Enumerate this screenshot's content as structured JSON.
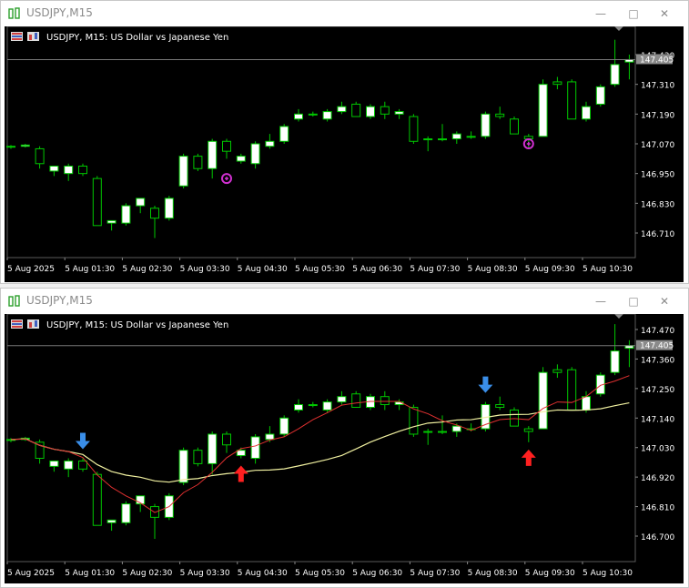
{
  "windows": [
    {
      "title": "USDJPY,M15",
      "chart_label": "USDJPY, M15:  US Dollar vs Japanese Yen",
      "current_price": "147.405",
      "y_ticks": [
        "147.430",
        "147.310",
        "147.190",
        "147.070",
        "146.950",
        "146.830",
        "146.710"
      ],
      "x_ticks": [
        "5 Aug 2025",
        "5 Aug 01:30",
        "5 Aug 02:30",
        "5 Aug 03:30",
        "5 Aug 04:30",
        "5 Aug 05:30",
        "5 Aug 06:30",
        "5 Aug 07:30",
        "5 Aug 08:30",
        "5 Aug 09:30",
        "5 Aug 10:30"
      ]
    },
    {
      "title": "USDJPY,M15",
      "chart_label": "USDJPY, M15:  US Dollar vs Japanese Yen",
      "current_price": "147.405",
      "y_ticks": [
        "147.470",
        "147.360",
        "147.250",
        "147.140",
        "147.030",
        "146.920",
        "146.810",
        "146.700"
      ],
      "x_ticks": [
        "5 Aug 2025",
        "5 Aug 01:30",
        "5 Aug 02:30",
        "5 Aug 03:30",
        "5 Aug 04:30",
        "5 Aug 05:30",
        "5 Aug 06:30",
        "5 Aug 07:30",
        "5 Aug 08:30",
        "5 Aug 09:30",
        "5 Aug 10:30"
      ]
    }
  ],
  "chart_data": [
    {
      "type": "candlestick",
      "symbol": "USDJPY",
      "timeframe": "M15",
      "candles": [
        {
          "o": 147.06,
          "h": 147.065,
          "l": 147.05,
          "c": 147.06
        },
        {
          "o": 147.06,
          "h": 147.07,
          "l": 147.055,
          "c": 147.065
        },
        {
          "o": 147.05,
          "h": 147.06,
          "l": 146.97,
          "c": 146.99
        },
        {
          "o": 146.96,
          "h": 146.98,
          "l": 146.94,
          "c": 146.98
        },
        {
          "o": 146.95,
          "h": 146.99,
          "l": 146.92,
          "c": 146.98
        },
        {
          "o": 146.98,
          "h": 146.99,
          "l": 146.94,
          "c": 146.95
        },
        {
          "o": 146.93,
          "h": 146.94,
          "l": 146.74,
          "c": 146.74
        },
        {
          "o": 146.75,
          "h": 146.76,
          "l": 146.72,
          "c": 146.76
        },
        {
          "o": 146.75,
          "h": 146.83,
          "l": 146.74,
          "c": 146.82
        },
        {
          "o": 146.82,
          "h": 146.85,
          "l": 146.79,
          "c": 146.85
        },
        {
          "o": 146.81,
          "h": 146.82,
          "l": 146.69,
          "c": 146.77
        },
        {
          "o": 146.77,
          "h": 146.86,
          "l": 146.76,
          "c": 146.85
        },
        {
          "o": 146.9,
          "h": 147.03,
          "l": 146.89,
          "c": 147.02
        },
        {
          "o": 147.02,
          "h": 147.03,
          "l": 146.96,
          "c": 146.97
        },
        {
          "o": 146.97,
          "h": 147.09,
          "l": 146.93,
          "c": 147.08
        },
        {
          "o": 147.08,
          "h": 147.09,
          "l": 147.01,
          "c": 147.04
        },
        {
          "o": 147.0,
          "h": 147.03,
          "l": 146.99,
          "c": 147.02
        },
        {
          "o": 146.99,
          "h": 147.08,
          "l": 146.97,
          "c": 147.07
        },
        {
          "o": 147.06,
          "h": 147.11,
          "l": 147.05,
          "c": 147.08
        },
        {
          "o": 147.08,
          "h": 147.15,
          "l": 147.07,
          "c": 147.14
        },
        {
          "o": 147.17,
          "h": 147.21,
          "l": 147.16,
          "c": 147.19
        },
        {
          "o": 147.19,
          "h": 147.2,
          "l": 147.18,
          "c": 147.19
        },
        {
          "o": 147.17,
          "h": 147.21,
          "l": 147.16,
          "c": 147.2
        },
        {
          "o": 147.2,
          "h": 147.24,
          "l": 147.19,
          "c": 147.22
        },
        {
          "o": 147.23,
          "h": 147.24,
          "l": 147.18,
          "c": 147.18
        },
        {
          "o": 147.18,
          "h": 147.23,
          "l": 147.17,
          "c": 147.22
        },
        {
          "o": 147.22,
          "h": 147.24,
          "l": 147.17,
          "c": 147.19
        },
        {
          "o": 147.19,
          "h": 147.21,
          "l": 147.17,
          "c": 147.2
        },
        {
          "o": 147.18,
          "h": 147.19,
          "l": 147.07,
          "c": 147.08
        },
        {
          "o": 147.09,
          "h": 147.1,
          "l": 147.04,
          "c": 147.09
        },
        {
          "o": 147.09,
          "h": 147.15,
          "l": 147.08,
          "c": 147.09
        },
        {
          "o": 147.09,
          "h": 147.12,
          "l": 147.07,
          "c": 147.11
        },
        {
          "o": 147.1,
          "h": 147.12,
          "l": 147.09,
          "c": 147.1
        },
        {
          "o": 147.1,
          "h": 147.2,
          "l": 147.09,
          "c": 147.19
        },
        {
          "o": 147.19,
          "h": 147.22,
          "l": 147.17,
          "c": 147.18
        },
        {
          "o": 147.17,
          "h": 147.18,
          "l": 147.11,
          "c": 147.11
        },
        {
          "o": 147.1,
          "h": 147.11,
          "l": 147.05,
          "c": 147.09
        },
        {
          "o": 147.1,
          "h": 147.33,
          "l": 147.1,
          "c": 147.31
        },
        {
          "o": 147.32,
          "h": 147.34,
          "l": 147.29,
          "c": 147.31
        },
        {
          "o": 147.32,
          "h": 147.33,
          "l": 147.17,
          "c": 147.17
        },
        {
          "o": 147.17,
          "h": 147.24,
          "l": 147.16,
          "c": 147.22
        },
        {
          "o": 147.23,
          "h": 147.31,
          "l": 147.22,
          "c": 147.3
        },
        {
          "o": 147.31,
          "h": 147.49,
          "l": 147.3,
          "c": 147.39
        },
        {
          "o": 147.4,
          "h": 147.43,
          "l": 147.33,
          "c": 147.41
        }
      ]
    },
    {
      "type": "candlestick",
      "symbol": "USDJPY",
      "timeframe": "M15",
      "indicators": [
        {
          "name": "fast MA",
          "color": "#e03030"
        },
        {
          "name": "slow MA",
          "color": "#f0f0a0"
        }
      ],
      "signals": [
        {
          "type": "sell",
          "candle": 5
        },
        {
          "type": "buy",
          "candle": 16
        },
        {
          "type": "sell",
          "candle": 33
        },
        {
          "type": "buy",
          "candle": 36
        }
      ]
    }
  ],
  "colors": {
    "bull": "#ffffff",
    "bear": "#000000",
    "wick": "#00c800",
    "grid": "#2a2a2a",
    "axis_text": "#ffffff",
    "buy_arrow": "#ff2020",
    "sell_arrow": "#3a8ee8",
    "marker": "#d030d0"
  }
}
